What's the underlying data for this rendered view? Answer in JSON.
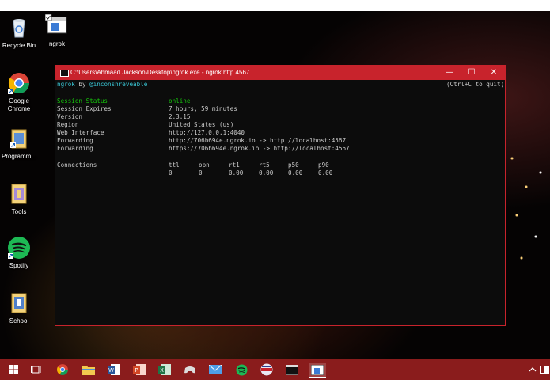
{
  "desktop_icons": {
    "recycle_bin": "Recycle Bin",
    "ngrok": "ngrok",
    "chrome": "Google Chrome",
    "programs": "Programm...",
    "tools": "Tools",
    "spotify": "Spotify",
    "school": "School"
  },
  "window": {
    "title": "C:\\Users\\Ahmaad Jackson\\Desktop\\ngrok.exe - ngrok  http 4567",
    "minimize": "—",
    "maximize": "☐",
    "close": "✕"
  },
  "terminal": {
    "header_name": "ngrok",
    "header_by": " by ",
    "header_author": "@inconshreveable",
    "quit_hint": "(Ctrl+C to quit)",
    "rows": [
      {
        "label": "Session Status",
        "value": "online"
      },
      {
        "label": "Session Expires",
        "value": "7 hours, 59 minutes"
      },
      {
        "label": "Version",
        "value": "2.3.15"
      },
      {
        "label": "Region",
        "value": "United States (us)"
      },
      {
        "label": "Web Interface",
        "value": "http://127.0.0.1:4040"
      },
      {
        "label": "Forwarding",
        "value": "http://706b694e.ngrok.io -> http://localhost:4567"
      },
      {
        "label": "Forwarding",
        "value": "https://706b694e.ngrok.io -> http://localhost:4567"
      }
    ],
    "connections_label": "Connections",
    "conn_headers": [
      "ttl",
      "opn",
      "rt1",
      "rt5",
      "p50",
      "p90"
    ],
    "conn_values": [
      "0",
      "0",
      "0.00",
      "0.00",
      "0.00",
      "0.00"
    ]
  },
  "taskbar": {
    "items": [
      "start",
      "task-view",
      "chrome",
      "file-explorer",
      "word",
      "powerpoint",
      "excel",
      "app",
      "mail",
      "spotify",
      "browser",
      "terminal",
      "ngrok-console"
    ]
  },
  "colors": {
    "accent": "#c8232c",
    "taskbar": "#8a1c1c",
    "terminal_bg": "#0c0c0c",
    "cyan": "#3ac7d6",
    "green": "#16c60c"
  }
}
